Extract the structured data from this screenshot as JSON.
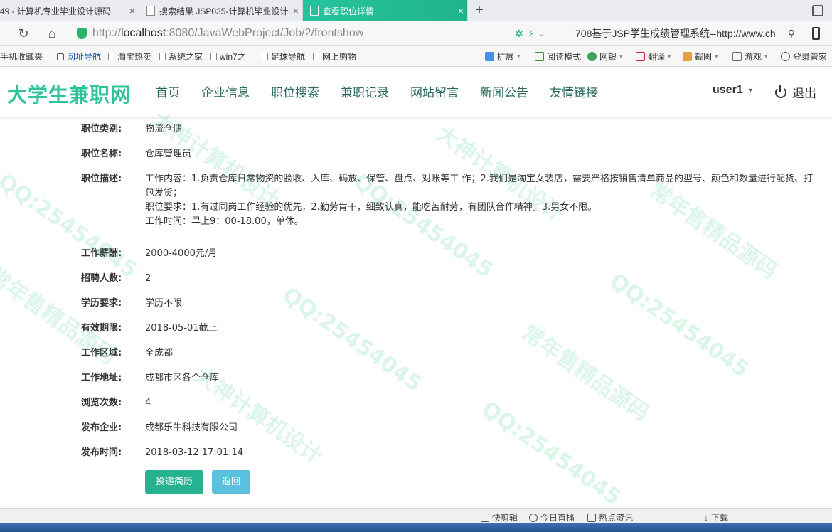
{
  "browser": {
    "tabs": [
      {
        "label": "49 - 计算机专业毕业设计源码",
        "active": false
      },
      {
        "label": "搜索结果 JSP035-计算机毕业设计",
        "active": false
      },
      {
        "label": "查看职位详情",
        "active": true
      }
    ],
    "address": {
      "prefix": "http://",
      "host": "localhost",
      "path": ":8080/JavaWebProject/Job/2/frontshow"
    },
    "search_text": "708基于JSP学生成绩管理系统--http://www.ch",
    "bookmarks": [
      "手机收藏夹",
      "网址导航",
      "淘宝热卖",
      "系统之家",
      "win7之",
      "足球导航",
      "网上购物"
    ],
    "tools": [
      "扩展",
      "阅读模式",
      "网银",
      "翻译",
      "截图",
      "游戏",
      "登录管家"
    ],
    "status_items": [
      "快剪辑",
      "今日直播",
      "热点资讯",
      "下载"
    ]
  },
  "site": {
    "logo": "大学生兼职网",
    "menu": [
      "首页",
      "企业信息",
      "职位搜索",
      "兼职记录",
      "网站留言",
      "新闻公告",
      "友情链接"
    ],
    "user": "user1",
    "logout": "退出"
  },
  "job": {
    "category": {
      "label": "职位类别:",
      "value": "物流仓储"
    },
    "name": {
      "label": "职位名称:",
      "value": "仓库管理员"
    },
    "description": {
      "label": "职位描述:",
      "line1": "工作内容：1.负责仓库日常物资的验收、入库、码放、保管、盘点、对账等工 作；2.我们是淘宝女装店，需要严格按销售清单商品的型号、颜色和数量进行配货、打包发货；",
      "line2": "职位要求：1.有过同岗工作经验的优先，2.勤劳肯干，细致认真，能吃苦耐劳，有团队合作精神。3.男女不限。",
      "line3": "工作时间：早上9：00-18.00，单休。"
    },
    "salary": {
      "label": "工作薪酬:",
      "value": "2000-4000元/月"
    },
    "headcount": {
      "label": "招聘人数:",
      "value": "2"
    },
    "education": {
      "label": "学历要求:",
      "value": "学历不限"
    },
    "valid_until": {
      "label": "有效期限:",
      "value": "2018-05-01截止"
    },
    "area": {
      "label": "工作区域:",
      "value": "全成都"
    },
    "address": {
      "label": "工作地址:",
      "value": "成都市区各个仓库"
    },
    "views": {
      "label": "浏览次数:",
      "value": "4"
    },
    "company": {
      "label": "发布企业:",
      "value": "成都乐牛科技有限公司"
    },
    "publish_time": {
      "label": "发布时间:",
      "value": "2018-03-12 17:01:14"
    }
  },
  "actions": {
    "submit": "投递简历",
    "back": "返回"
  },
  "watermarks": [
    "QQ:25454045",
    "大神计算机设计",
    "常年售精品源码"
  ],
  "colors": {
    "brand": "#2ec499",
    "tab_active": "#27c39c",
    "btn_submit": "#26b28f",
    "btn_back": "#5bc0de"
  }
}
